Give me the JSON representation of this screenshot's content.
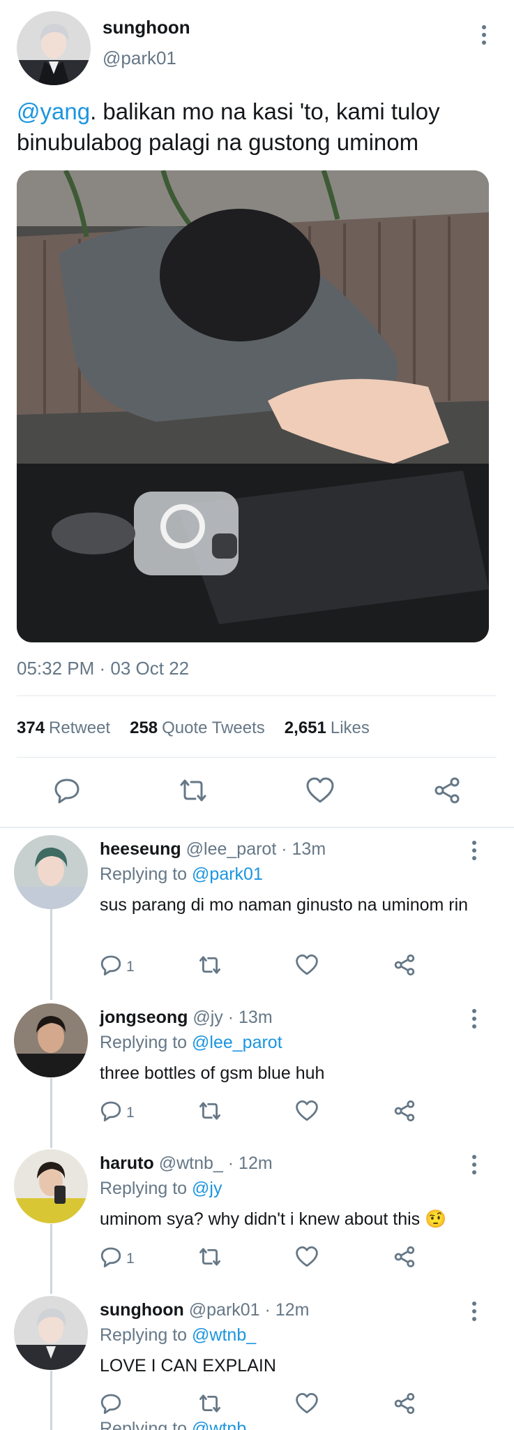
{
  "main_tweet": {
    "display_name": "sunghoon",
    "handle": "@park01",
    "mention": "@yang",
    "text": ". balikan mo na kasi 'to, kami tuloy binubulabog palagi na gustong uminom",
    "timestamp": "05:32 PM · 03 Oct 22",
    "stats": {
      "retweets_count": "374",
      "retweets_label": "Retweet",
      "quotes_count": "258",
      "quotes_label": "Quote Tweets",
      "likes_count": "2,651",
      "likes_label": "Likes"
    },
    "actions": [
      "reply-icon",
      "retweet-icon",
      "like-icon",
      "share-icon"
    ]
  },
  "replies": [
    {
      "name": "heeseung",
      "handle": "@lee_parot",
      "time": "· 13m",
      "replying_label": "Replying to",
      "replying_to": "@park01",
      "text": "sus parang di mo naman ginusto na uminom rin",
      "reply_count": "1"
    },
    {
      "name": "jongseong",
      "handle": "@jy",
      "time": "· 13m",
      "replying_label": "Replying to",
      "replying_to": "@lee_parot",
      "text": "three bottles of gsm blue huh",
      "reply_count": "1"
    },
    {
      "name": "haruto",
      "handle": "@wtnb_",
      "time": "· 12m",
      "replying_label": "Replying to",
      "replying_to": "@jy",
      "text": "uminom sya? why didn't i knew about this 🤨",
      "reply_count": "1"
    },
    {
      "name": "sunghoon",
      "handle": "@park01",
      "time": "· 12m",
      "replying_label": "Replying to",
      "replying_to": "@wtnb_",
      "text": "LOVE I CAN EXPLAIN",
      "reply_count": ""
    }
  ],
  "partial_next": {
    "replying_label": "Replying to",
    "replying_to": "@wtnb_"
  },
  "colors": {
    "accent": "#1b95e0",
    "secondary_text": "#657786",
    "divider": "#e1e8ed"
  }
}
